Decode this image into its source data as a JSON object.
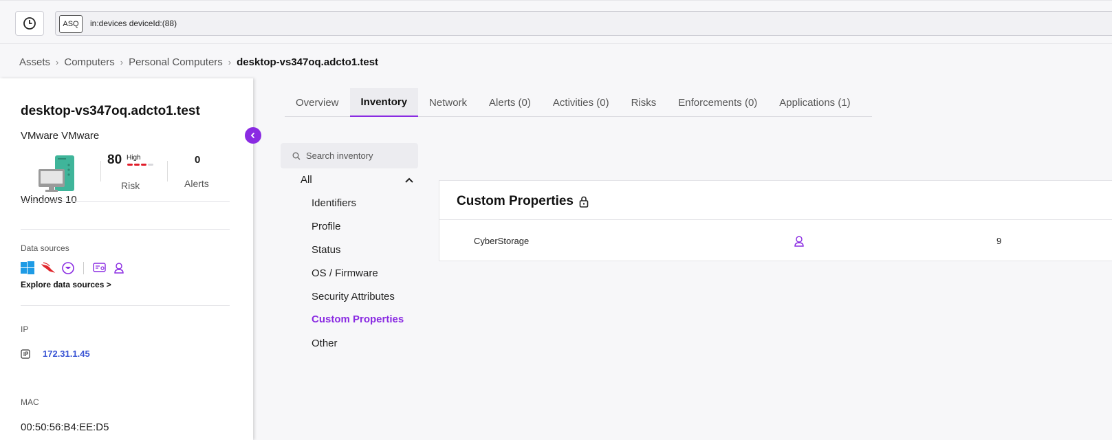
{
  "query": {
    "badge": "ASQ",
    "text": "in:devices deviceId:(88)"
  },
  "breadcrumb": {
    "items": [
      "Assets",
      "Computers",
      "Personal Computers"
    ],
    "current": "desktop-vs347oq.adcto1.test"
  },
  "device": {
    "name": "desktop-vs347oq.adcto1.test",
    "vendor": "VMware  VMware",
    "risk": {
      "value": "80",
      "level": "High",
      "label": "Risk",
      "bars_filled": 3,
      "bars_total": 4
    },
    "alerts": {
      "value": "0",
      "label": "Alerts"
    },
    "os": "Windows 10",
    "data_sources": {
      "label": "Data sources",
      "explore": "Explore data sources >",
      "icons": [
        "windows-icon",
        "crowdstrike-icon",
        "armis-icon",
        "sensor-icon",
        "custom-user-icon"
      ]
    },
    "ip": {
      "label": "IP",
      "value": "172.31.1.45"
    },
    "mac": {
      "label": "MAC",
      "value": "00:50:56:B4:EE:D5"
    }
  },
  "tabs": [
    "Overview",
    "Inventory",
    "Network",
    "Alerts (0)",
    "Activities (0)",
    "Risks",
    "Enforcements (0)",
    "Applications (1)"
  ],
  "active_tab": "Inventory",
  "inventory": {
    "search_placeholder": "Search inventory",
    "all_label": "All",
    "items": [
      "Identifiers",
      "Profile",
      "Status",
      "OS / Firmware",
      "Security Attributes",
      "Custom Properties",
      "Other"
    ],
    "active_item": "Custom Properties"
  },
  "custom_properties": {
    "title": "Custom Properties",
    "rows": [
      {
        "name": "CyberStorage",
        "value": "9"
      }
    ]
  },
  "colors": {
    "accent": "#8a2be2",
    "risk": "#e11d2a",
    "link": "#3a55d4"
  }
}
